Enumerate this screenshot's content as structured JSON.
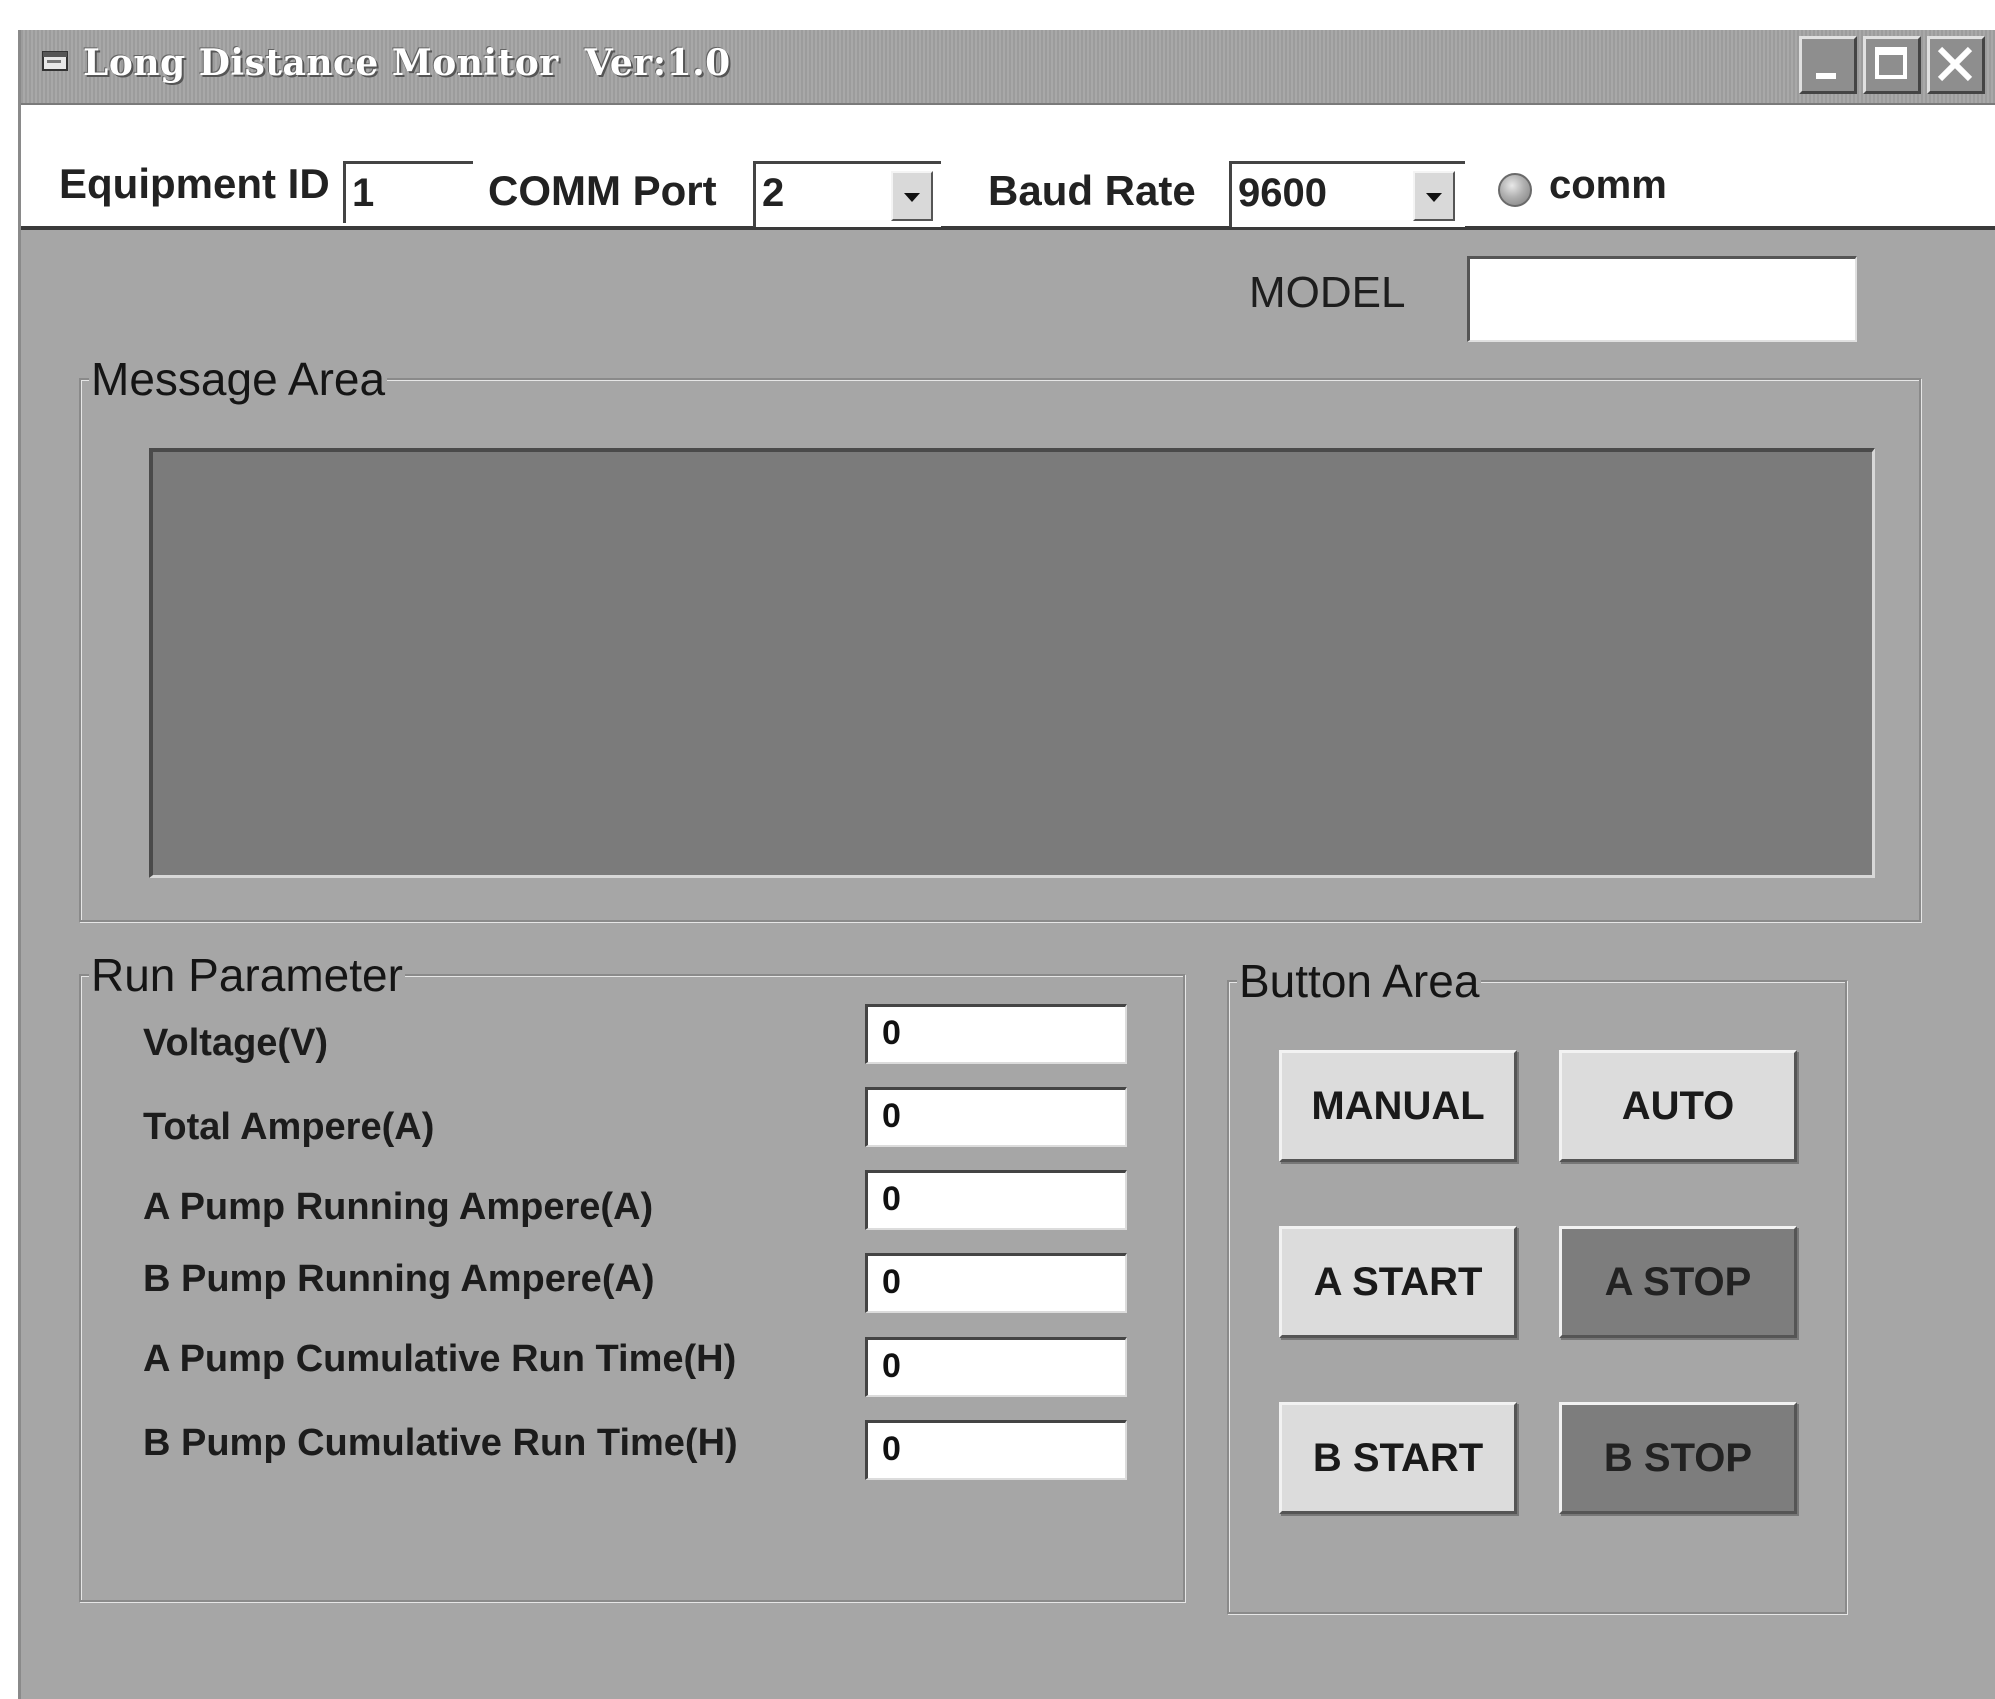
{
  "window": {
    "title": "Long Distance Monitor  Ver:1.0",
    "icon": "app-window-icon",
    "controls": [
      "minimize-icon",
      "maximize-icon",
      "close-icon"
    ]
  },
  "toolbar": {
    "equipment_id_label": "Equipment ID",
    "equipment_id_value": "1",
    "comm_port_label": "COMM Port",
    "comm_port_value": "2",
    "baud_rate_label": "Baud Rate",
    "baud_rate_value": "9600",
    "comm_indicator_label": "comm"
  },
  "model": {
    "label": "MODEL",
    "value": ""
  },
  "message_area": {
    "title": "Message Area"
  },
  "run_parameter": {
    "title": "Run Parameter",
    "rows": [
      {
        "label": "Voltage(V)",
        "value": "0"
      },
      {
        "label": "Total Ampere(A)",
        "value": "0"
      },
      {
        "label": "A Pump Running Ampere(A)",
        "value": "0"
      },
      {
        "label": "B Pump Running Ampere(A)",
        "value": "0"
      },
      {
        "label": "A Pump Cumulative Run Time(H)",
        "value": "0"
      },
      {
        "label": "B Pump Cumulative Run Time(H)",
        "value": "0"
      }
    ]
  },
  "button_area": {
    "title": "Button Area",
    "manual": "MANUAL",
    "auto": "AUTO",
    "a_start": "A START",
    "a_stop": "A STOP",
    "b_start": "B START",
    "b_stop": "B STOP"
  },
  "colors": {
    "panel_background": "#a6a6a6",
    "message_display": "#7b7b7b",
    "light_button": "#dcdcdc",
    "dark_button": "#7d7d7d"
  }
}
